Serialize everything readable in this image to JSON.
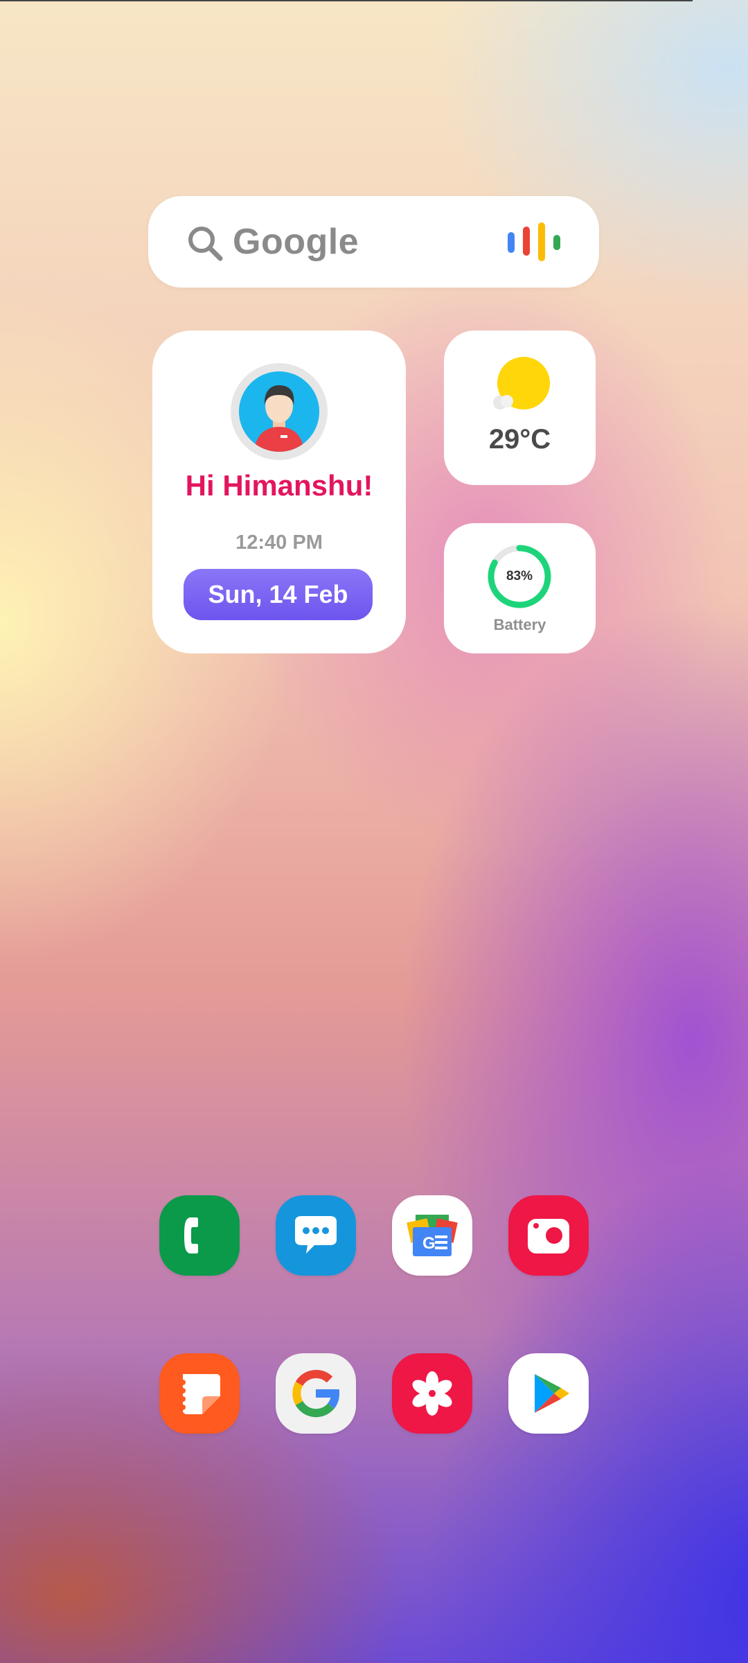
{
  "search": {
    "label": "Google",
    "icon": "search-icon",
    "voice_icon": "google-mic-icon",
    "voice_colors": [
      "#4285F4",
      "#EA4335",
      "#FBBC05",
      "#34A853"
    ]
  },
  "profile": {
    "greeting": "Hi Himanshu!",
    "time": "12:40 PM",
    "date": "Sun, 14 Feb",
    "accent": "#e3155f",
    "pill_color": "#7a63f2"
  },
  "weather": {
    "temperature": "29°C",
    "icon": "sun-cloud-icon"
  },
  "battery": {
    "percent_text": "83%",
    "percent": 0.83,
    "label": "Battery",
    "color": "#1ed47a"
  },
  "dock": {
    "row1": [
      {
        "name": "phone",
        "icon": "phone-icon",
        "color": "#0a9a4a"
      },
      {
        "name": "messages",
        "icon": "messages-icon",
        "color": "#1596dc"
      },
      {
        "name": "news",
        "icon": "google-news-icon",
        "color": "#ffffff"
      },
      {
        "name": "camera",
        "icon": "camera-icon",
        "color": "#ee1745"
      }
    ],
    "row2": [
      {
        "name": "notes",
        "icon": "notes-icon",
        "color": "#ff5a1f"
      },
      {
        "name": "google",
        "icon": "google-g-icon",
        "color": "#f1f1f1"
      },
      {
        "name": "gallery",
        "icon": "gallery-flower-icon",
        "color": "#ee1745"
      },
      {
        "name": "play-store",
        "icon": "play-store-icon",
        "color": "#ffffff"
      }
    ]
  }
}
